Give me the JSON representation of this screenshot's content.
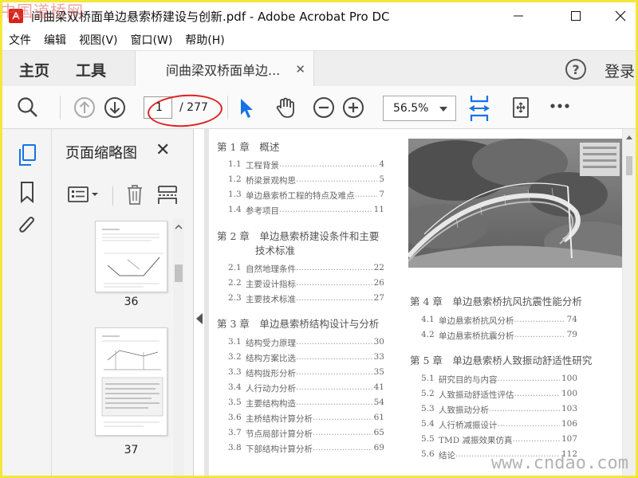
{
  "window": {
    "title": "间曲梁双桥面单边悬索桥建设与创新.pdf - Adobe Acrobat Pro DC"
  },
  "watermark": {
    "top": "中国道桥网",
    "bottom": "www.cndao.com"
  },
  "menu": [
    "文件",
    "编辑",
    "视图(V)",
    "窗口(W)",
    "帮助(H)"
  ],
  "tabs": {
    "home": "主页",
    "tools": "工具",
    "document": "间曲梁双桥面单边...",
    "login": "登录"
  },
  "toolbar": {
    "current_page": "1",
    "total_pages": "/ 277",
    "zoom": "56.5%"
  },
  "panel": {
    "title": "页面缩略图",
    "thumbnails": [
      {
        "number": "36"
      },
      {
        "number": "37"
      }
    ]
  },
  "document": {
    "left_column": [
      {
        "chapter": "第 1 章　概述",
        "items": [
          {
            "num": "1.1",
            "label": "工程背景",
            "page": "4"
          },
          {
            "num": "1.2",
            "label": "桥梁景观构思",
            "page": "5"
          },
          {
            "num": "1.3",
            "label": "单边悬索桥工程的特点及难点",
            "page": "7"
          },
          {
            "num": "1.4",
            "label": "参考项目",
            "page": "11"
          }
        ]
      },
      {
        "chapter": "第 2 章　单边悬索桥建设条件和主要",
        "chapter_line2": "技术标准",
        "items": [
          {
            "num": "2.1",
            "label": "自然地理条件",
            "page": "22"
          },
          {
            "num": "2.2",
            "label": "主要设计指标",
            "page": "26"
          },
          {
            "num": "2.3",
            "label": "主要技术标准",
            "page": "27"
          }
        ]
      },
      {
        "chapter": "第 3 章　单边悬索桥结构设计与分析",
        "items": [
          {
            "num": "3.1",
            "label": "结构受力原理",
            "page": "30"
          },
          {
            "num": "3.2",
            "label": "结构方案比选",
            "page": "33"
          },
          {
            "num": "3.3",
            "label": "结构拢形分析",
            "page": "35"
          },
          {
            "num": "3.4",
            "label": "人行动力分析",
            "page": "41"
          },
          {
            "num": "3.5",
            "label": "主要结构构造",
            "page": "54"
          },
          {
            "num": "3.6",
            "label": "主桥结构计算分析",
            "page": "61"
          },
          {
            "num": "3.7",
            "label": "节点局部计算分析",
            "page": "65"
          },
          {
            "num": "3.8",
            "label": "下部结构计算分析",
            "page": "69"
          }
        ]
      }
    ],
    "right_column": [
      {
        "chapter": "第 4 章　单边悬索桥抗风抗震性能分析",
        "items": [
          {
            "num": "4.1",
            "label": "单边悬索桥抗风分析",
            "page": "74"
          },
          {
            "num": "4.2",
            "label": "单边悬索桥抗震分析",
            "page": "79"
          }
        ]
      },
      {
        "chapter": "第 5 章　单边悬索桥人致振动舒适性研究",
        "items": [
          {
            "num": "5.1",
            "label": "研究目的与内容",
            "page": "100"
          },
          {
            "num": "5.2",
            "label": "人致振动舒适性评估",
            "page": "100"
          },
          {
            "num": "5.3",
            "label": "人致振动分析",
            "page": "103"
          },
          {
            "num": "5.4",
            "label": "人行桥减振设计",
            "page": "106"
          },
          {
            "num": "5.5",
            "label": "TMD 减振效果仿真",
            "page": "107"
          },
          {
            "num": "5.6",
            "label": "结论",
            "page": "112"
          }
        ]
      }
    ]
  },
  "colors": {
    "accent_blue": "#1473e6",
    "annotation_red": "#e02020",
    "watermark_yellow": "#f5e63a"
  }
}
